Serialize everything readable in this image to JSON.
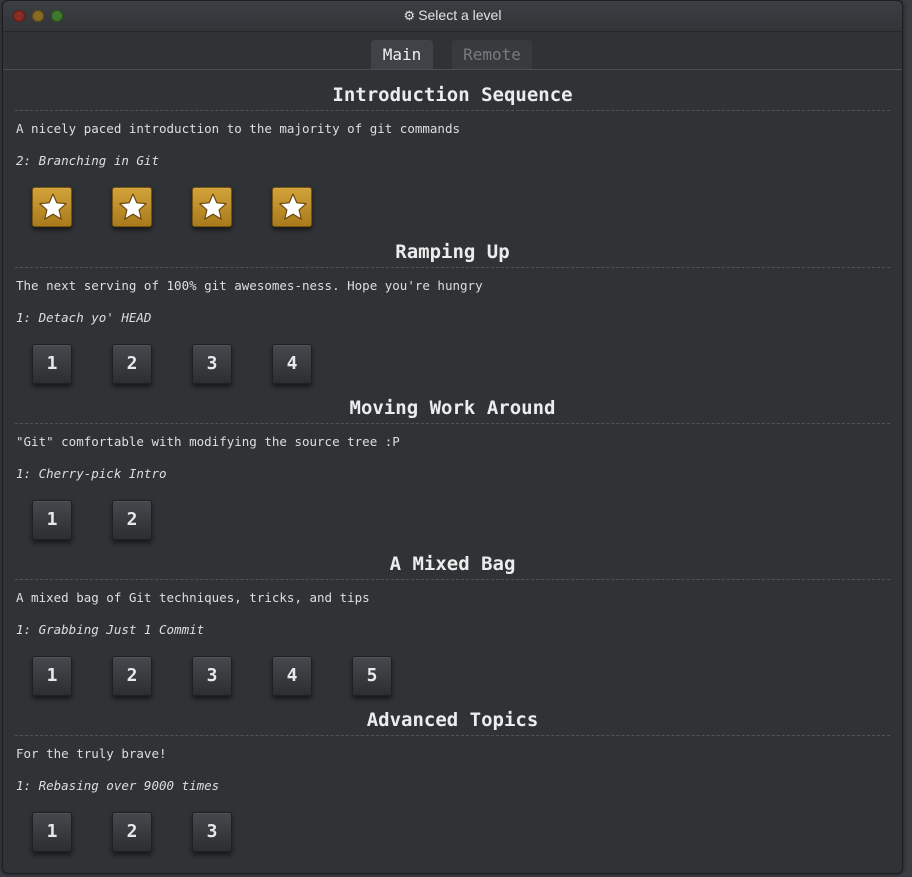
{
  "window": {
    "title": "Select a level",
    "title_icon": "gear-icon"
  },
  "tabs": [
    {
      "label": "Main",
      "active": true
    },
    {
      "label": "Remote",
      "active": false
    }
  ],
  "colors": {
    "completed_level": "#c4962d",
    "level_button": "#3a3d41",
    "background": "#303335"
  },
  "sections": [
    {
      "title": "Introduction Sequence",
      "description": "A nicely paced introduction to the majority of git commands",
      "next_level": "2: Branching in Git",
      "levels": [
        {
          "label": "1",
          "completed": true
        },
        {
          "label": "2",
          "completed": true
        },
        {
          "label": "3",
          "completed": true
        },
        {
          "label": "4",
          "completed": true
        }
      ]
    },
    {
      "title": "Ramping Up",
      "description": "The next serving of 100% git awesomes-ness. Hope you're hungry",
      "next_level": "1: Detach yo' HEAD",
      "levels": [
        {
          "label": "1",
          "completed": false
        },
        {
          "label": "2",
          "completed": false
        },
        {
          "label": "3",
          "completed": false
        },
        {
          "label": "4",
          "completed": false
        }
      ]
    },
    {
      "title": "Moving Work Around",
      "description": "\"Git\" comfortable with modifying the source tree :P",
      "next_level": "1: Cherry-pick Intro",
      "levels": [
        {
          "label": "1",
          "completed": false
        },
        {
          "label": "2",
          "completed": false
        }
      ]
    },
    {
      "title": "A Mixed Bag",
      "description": "A mixed bag of Git techniques, tricks, and tips",
      "next_level": "1: Grabbing Just 1 Commit",
      "levels": [
        {
          "label": "1",
          "completed": false
        },
        {
          "label": "2",
          "completed": false
        },
        {
          "label": "3",
          "completed": false
        },
        {
          "label": "4",
          "completed": false
        },
        {
          "label": "5",
          "completed": false
        }
      ]
    },
    {
      "title": "Advanced Topics",
      "description": "For the truly brave!",
      "next_level": "1: Rebasing over 9000 times",
      "levels": [
        {
          "label": "1",
          "completed": false
        },
        {
          "label": "2",
          "completed": false
        },
        {
          "label": "3",
          "completed": false
        }
      ]
    }
  ]
}
